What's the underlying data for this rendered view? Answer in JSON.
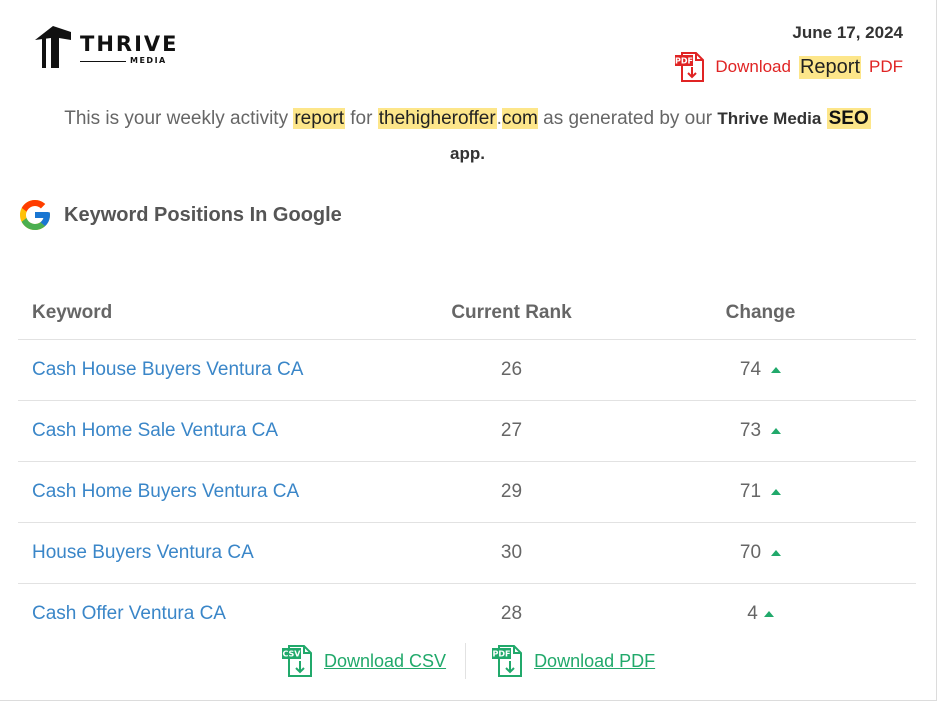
{
  "header": {
    "brand": "THRIVE",
    "brand_sub": "MEDIA",
    "date": "June 17, 2024",
    "download_report": {
      "prefix": "Download",
      "highlight": "Report",
      "suffix": "PDF",
      "icon_label": "PDF"
    }
  },
  "intro": {
    "part1": "This is your weekly activity",
    "word_report": "report",
    "part2": "for",
    "domain_name": "thehigheroffer",
    "domain_tld": ".com",
    "part3": "as generated by our",
    "company": "Thrive Media",
    "seo": "SEO",
    "app": "app."
  },
  "section": {
    "title": "Keyword Positions In Google",
    "icon": "google-g-icon"
  },
  "table": {
    "headers": {
      "keyword": "Keyword",
      "rank": "Current Rank",
      "change": "Change"
    },
    "rows": [
      {
        "keyword": "Cash House Buyers Ventura CA",
        "rank": "26",
        "change": "74",
        "direction": "up"
      },
      {
        "keyword": "Cash Home Sale Ventura CA",
        "rank": "27",
        "change": "73",
        "direction": "up"
      },
      {
        "keyword": "Cash Home Buyers Ventura CA",
        "rank": "29",
        "change": "71",
        "direction": "up"
      },
      {
        "keyword": "House Buyers Ventura CA",
        "rank": "30",
        "change": "70",
        "direction": "up"
      },
      {
        "keyword": "Cash Offer Ventura CA",
        "rank": "28",
        "change": "4",
        "direction": "up"
      }
    ]
  },
  "downloads": {
    "csv_label": "Download CSV",
    "csv_icon_label": "CSV",
    "pdf_label": "Download PDF",
    "pdf_icon_label": "PDF"
  },
  "colors": {
    "accent_red": "#e02424",
    "link_blue": "#3a86c8",
    "green": "#21a96b",
    "highlight": "#fde68a"
  }
}
